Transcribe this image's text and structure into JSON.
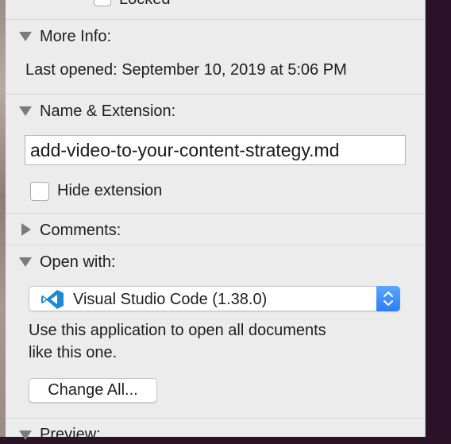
{
  "general": {
    "locked_label": "Locked"
  },
  "more_info": {
    "header": "More Info:",
    "last_opened": "Last opened: September 10, 2019 at 5:06 PM"
  },
  "name_extension": {
    "header": "Name & Extension:",
    "filename": "add-video-to-your-content-strategy.md",
    "hide_extension_label": "Hide extension",
    "hide_extension_checked": false
  },
  "comments": {
    "header": "Comments:"
  },
  "open_with": {
    "header": "Open with:",
    "app_icon": "visual-studio-code-icon",
    "app_icon_color": "#1f8ad2",
    "selected_app": "Visual Studio Code (1.38.0)",
    "description_line1": "Use this application to open all documents",
    "description_line2": "like this one.",
    "change_all_label": "Change All..."
  },
  "preview": {
    "header": "Preview:"
  }
}
